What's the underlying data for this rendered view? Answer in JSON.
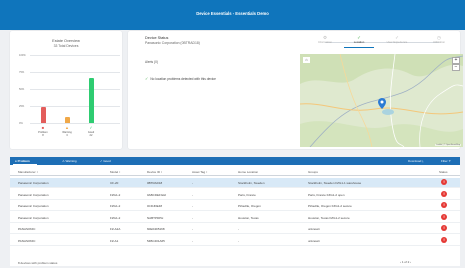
{
  "banner": {
    "title": "Device Essentials - Essentials Demo"
  },
  "fleet": {
    "title": "Estate Overview",
    "subtitle": "33 Total Devices",
    "y_ticks": [
      "100%",
      "75%",
      "50%",
      "25%",
      "0%"
    ],
    "chart_data": {
      "type": "bar",
      "categories": [
        "Problem",
        "Warning",
        "Good"
      ],
      "values": [
        8,
        3,
        22
      ],
      "category_labels": [
        {
          "name": "Problem",
          "count": "8"
        },
        {
          "name": "Warning",
          "count": "3"
        },
        {
          "name": "Good",
          "count": "22"
        }
      ],
      "ylim": [
        0,
        1
      ],
      "y_format": "percent of total",
      "colors": [
        "#e35d5b",
        "#f0a848",
        "#2ecc71"
      ]
    }
  },
  "device_status": {
    "title": "Device Status",
    "device": "Panasonic Corporation (0BTRAD18)",
    "steps": [
      {
        "label": "Information",
        "icon": "gear-icon",
        "glyph": "⚙",
        "active": false
      },
      {
        "label": "Location",
        "icon": "check-icon",
        "glyph": "✓",
        "active": true
      },
      {
        "label": "User Experience",
        "icon": "check-icon",
        "glyph": "✓",
        "active": false
      },
      {
        "label": "Utilization",
        "icon": "clock-icon",
        "glyph": "◷",
        "active": false
      }
    ]
  },
  "alerts": {
    "title": "Alerts (0)",
    "message": "No location problems detected with this device"
  },
  "map": {
    "zoom_in": "+",
    "zoom_out": "−",
    "corner": "⌂",
    "attribution": "Leaflet | © OpenStreetMap",
    "pin_color": "#2b7bd4"
  },
  "table": {
    "tabs": [
      {
        "label": "● Problem",
        "active": true
      },
      {
        "label": "⚠ Warning",
        "active": false
      },
      {
        "label": "✓ Good",
        "active": false
      }
    ],
    "download": "Download ⤓",
    "filter": "Filter ⏷",
    "columns": [
      "Manufacturer ↕",
      "Model ↕",
      "Device ID ↕",
      "Asset Tag ↕",
      "Home Location",
      "Groups",
      "Status"
    ],
    "rows": [
      {
        "manufacturer": "Panasonic Corporation",
        "model": "CF-20",
        "device_id": "0BTRAD18",
        "asset_tag": "-",
        "home": "Stockholm, Sweden",
        "groups": "Stockholm, Sweden FZG1-1 warehouse",
        "selected": true
      },
      {
        "manufacturer": "Panasonic Corporation",
        "model": "FZG1-2",
        "device_id": "0ABCDEFGHI",
        "asset_tag": "-",
        "home": "Paris, France",
        "groups": "Paris, France FZG1-2 open",
        "selected": false
      },
      {
        "manufacturer": "Panasonic Corporation",
        "model": "FZG1-2",
        "device_id": "0CDJDE48",
        "asset_tag": "-",
        "home": "Pirlaville, Oregon",
        "groups": "Pirlaville, Oregon FZG1-2 secure",
        "selected": false
      },
      {
        "manufacturer": "Panasonic Corporation",
        "model": "FZG1-2",
        "device_id": "NABTPDPH",
        "asset_tag": "-",
        "home": "Houston, Texas",
        "groups": "Houston, Texas FZG1-2 secure",
        "selected": false
      },
      {
        "manufacturer": "PANASONIC",
        "model": "FZ-A2A",
        "device_id": "60E04D5168",
        "asset_tag": "-",
        "home": "-",
        "groups": "unknown",
        "selected": false
      },
      {
        "manufacturer": "PANASONIC",
        "model": "FZ-A1",
        "device_id": "54BC401A65",
        "asset_tag": "-",
        "home": "-",
        "groups": "unknown",
        "selected": false
      }
    ],
    "footer_count": "8 devices with problem status",
    "pagination": "‹ 1 of 2 ›",
    "status_glyph": "!"
  }
}
